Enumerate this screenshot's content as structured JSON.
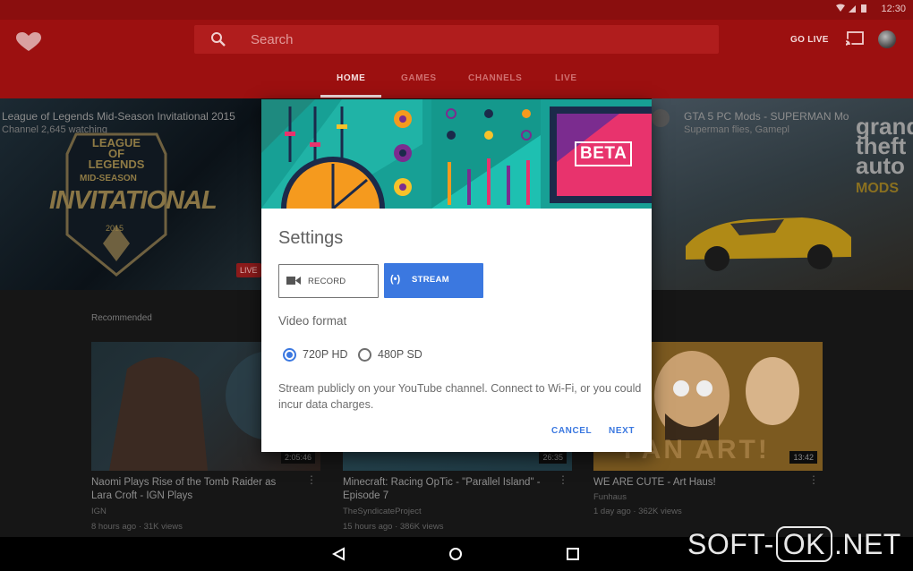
{
  "status": {
    "clock": "12:30"
  },
  "search": {
    "placeholder": "Search"
  },
  "header": {
    "go_live": "GO LIVE"
  },
  "tabs": [
    {
      "label": "HOME",
      "active": true
    },
    {
      "label": "GAMES",
      "active": false
    },
    {
      "label": "CHANNELS",
      "active": false
    },
    {
      "label": "LIVE",
      "active": false
    }
  ],
  "hero": {
    "left_title": "League of Legends Mid-Season Invitational 2015",
    "left_sub": "Channel 2,645 watching",
    "crest": {
      "line1": "LEAGUE OF LEGENDS",
      "line2": "MID-SEASON",
      "line3": "INVITATIONAL",
      "year": "2015"
    },
    "live_badge": "LIVE",
    "right_title": "GTA 5 PC Mods - SUPERMAN Mo",
    "right_sub": "Superman flies, Gamepl",
    "gta_logo": {
      "l1": "grand",
      "l2": "theft",
      "l3": "auto",
      "mods": "MODS"
    }
  },
  "recommended_label": "Recommended",
  "cards": [
    {
      "title": "Naomi Plays Rise of the Tomb Raider as Lara Croft - IGN Plays",
      "channel": "IGN",
      "meta": "8 hours ago · 31K views",
      "duration": "2:05:46"
    },
    {
      "title": "Minecraft: Racing OpTic - \"Parallel Island\" - Episode 7",
      "channel": "TheSyndicateProject",
      "meta": "15 hours ago · 386K views",
      "duration": "26:35"
    },
    {
      "title": "WE ARE CUTE - Art Haus!",
      "channel": "Funhaus",
      "meta": "1 day ago · 362K views",
      "duration": "13:42",
      "thumb_text": "FAN ART!"
    }
  ],
  "dialog": {
    "banner_badge": "BETA",
    "title": "Settings",
    "record_label": "RECORD",
    "stream_label": "STREAM",
    "stream_icon": "(•)",
    "video_format_label": "Video format",
    "options": [
      {
        "label": "720P HD",
        "selected": true
      },
      {
        "label": "480P SD",
        "selected": false
      }
    ],
    "description": "Stream publicly on your YouTube channel. Connect to Wi-Fi, or you could incur data charges.",
    "cancel_label": "CANCEL",
    "next_label": "NEXT"
  },
  "watermark": {
    "left": "SOFT-",
    "ok": "OK",
    "right": ".NET"
  },
  "icons": {
    "logo": "heart-logo-icon",
    "search": "search-icon",
    "cast": "cast-icon",
    "record": "videocam-icon",
    "stream": "broadcast-icon",
    "nav_back": "back-triangle-icon",
    "nav_home": "home-circle-icon",
    "nav_recents": "recents-square-icon"
  },
  "colors": {
    "appbar": "#9c1010",
    "accent": "#3b78e0",
    "banner": "#17a095"
  }
}
